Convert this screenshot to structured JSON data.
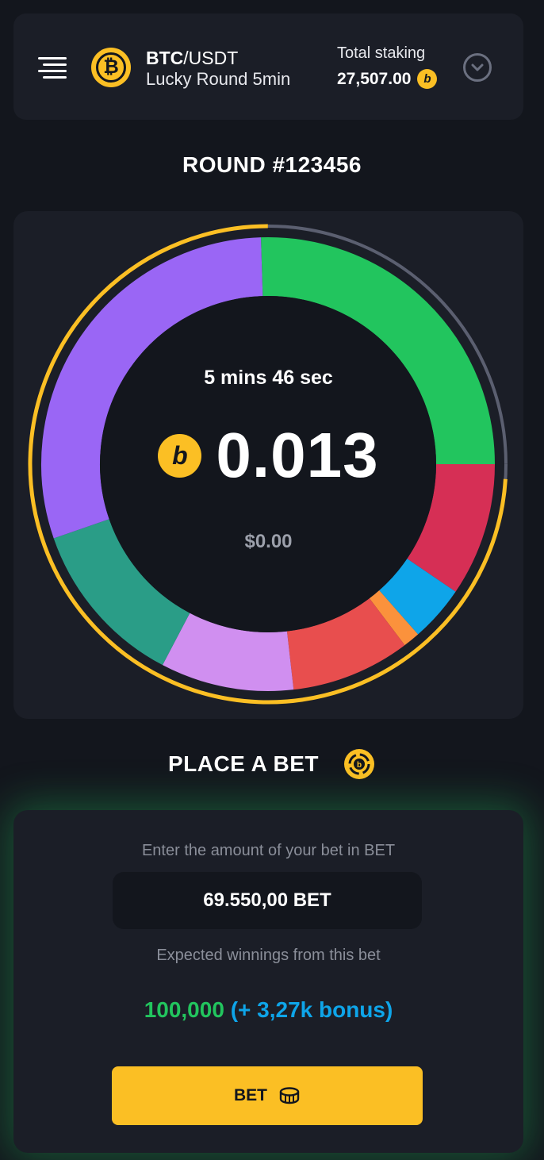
{
  "header": {
    "pair_base": "BTC",
    "pair_quote": "/USDT",
    "round_type": "Lucky Round 5min",
    "staking_label": "Total staking",
    "staking_value": "27,507.00",
    "icons": [
      "menu-icon",
      "bitcoin-icon",
      "bet-coin-icon",
      "chevron-down-icon"
    ]
  },
  "round": {
    "title": "ROUND #123456",
    "timer": "5 mins 46 sec",
    "amount": "0.013",
    "usd": "$0.00",
    "timer_progress": 0.74,
    "segments": [
      {
        "color": "#22c55e",
        "share": 0.255
      },
      {
        "color": "#d62f55",
        "share": 0.095
      },
      {
        "color": "#0ea5e9",
        "share": 0.04
      },
      {
        "color": "#fb923c",
        "share": 0.012
      },
      {
        "color": "#e84e4e",
        "share": 0.085
      },
      {
        "color": "#d08ff0",
        "share": 0.095
      },
      {
        "color": "#2a9d87",
        "share": 0.12
      },
      {
        "color": "#9a66f5",
        "share": 0.298
      }
    ]
  },
  "bet": {
    "title": "PLACE A BET",
    "amount_hint": "Enter the amount of your bet in BET",
    "amount_value": "69.550,00 BET",
    "winnings_hint": "Expected winnings from this bet",
    "winnings_main": "100,000",
    "winnings_bonus": "(+ 3,27k bonus)",
    "button_label": "BET"
  },
  "colors": {
    "accent": "#fbbf24",
    "background": "#13161d",
    "card": "#1b1e27",
    "positive": "#22c55e",
    "bonus": "#0ea5e9"
  }
}
